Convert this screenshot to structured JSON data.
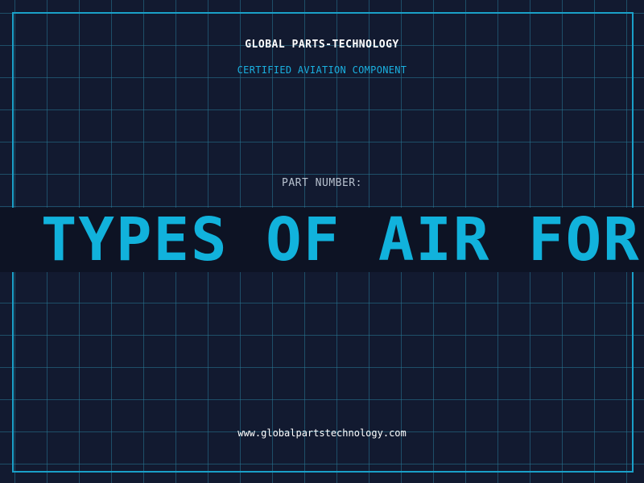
{
  "header": {
    "company": "GLOBAL PARTS-TECHNOLOGY",
    "tagline": "CERTIFIED AVIATION COMPONENT"
  },
  "part": {
    "label": "PART NUMBER:",
    "value": "L TYPES OF AIR FORC"
  },
  "footer": {
    "website": "www.globalpartstechnology.com"
  },
  "colors": {
    "background": "#121a30",
    "grid": "#28788f",
    "frame": "#1aa0c8",
    "accent": "#11b2dc",
    "banner": "#0d1324"
  }
}
